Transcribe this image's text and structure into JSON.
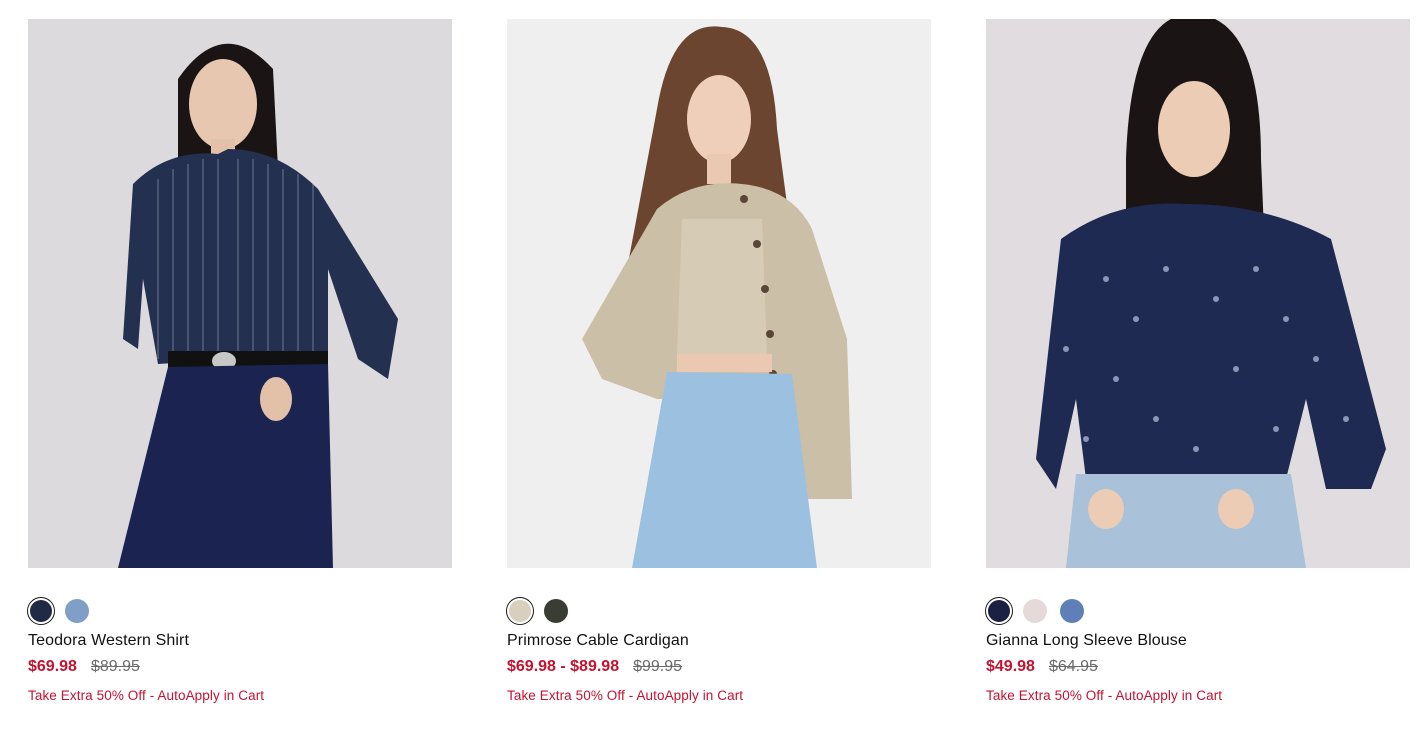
{
  "products": [
    {
      "name": "Teodora Western Shirt",
      "sale_price": "$69.98",
      "original_price": "$89.95",
      "promo": "Take Extra 50% Off - AutoApply in Cart",
      "image_alt": "Woman wearing navy pinstripe western shirt with dark jeans",
      "swatches": [
        {
          "color": "#1f2a44",
          "selected": true
        },
        {
          "color": "#7f9fc6",
          "selected": false
        }
      ]
    },
    {
      "name": "Primrose Cable Cardigan",
      "sale_price": "$69.98 - $89.98",
      "original_price": "$99.95",
      "promo": "Take Extra 50% Off - AutoApply in Cart",
      "image_alt": "Woman wearing beige cable knit cardigan set with light wash jeans",
      "swatches": [
        {
          "color": "#d9cfbd",
          "selected": true
        },
        {
          "color": "#3a3d33",
          "selected": false
        }
      ]
    },
    {
      "name": "Gianna Long Sleeve Blouse",
      "sale_price": "$49.98",
      "original_price": "$64.95",
      "promo": "Take Extra 50% Off - AutoApply in Cart",
      "image_alt": "Woman wearing navy floral print ruffle blouse with jeans",
      "swatches": [
        {
          "color": "#1b2142",
          "selected": true
        },
        {
          "color": "#e6d9d9",
          "selected": false
        },
        {
          "color": "#5f7fb8",
          "selected": false
        }
      ]
    }
  ],
  "colors": {
    "sale": "#c41230",
    "original": "#6b6b6b"
  }
}
